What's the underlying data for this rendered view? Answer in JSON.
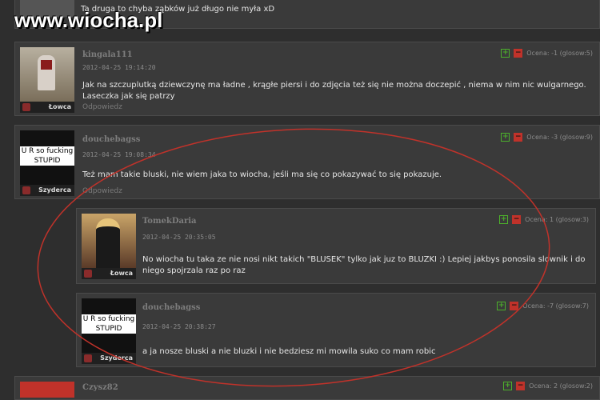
{
  "watermark": "www.wiocha.pl",
  "comments": [
    {
      "text": "Ta druga to chyba ząbków już długo nie myła xD"
    },
    {
      "user": "kingala111",
      "date": "2012-04-25 19:14:20",
      "text": "Jak na szczuplutką dziewczynę ma ładne , krągłe piersi i do zdjęcia też się nie można doczepić , niema w nim nic wulgarnego. Laseczka jak się patrzy",
      "rank": "Łowca",
      "rating": "Ocena: -1 (glosow:5)",
      "reply": "Odpowiedz"
    },
    {
      "user": "douchebagss",
      "date": "2012-04-25 19:08:34",
      "text": "Też mam takie bluski, nie wiem jaka to wiocha, jeśli ma się co pokazywać to się pokazuje.",
      "rank": "Szyderca",
      "rating": "Ocena: -3 (glosow:9)",
      "reply": "Odpowiedz",
      "avatar_text": "U R so fucking STUPID"
    },
    {
      "user": "TomekDaria",
      "date": "2012-04-25 20:35:05",
      "text": "No wiocha tu taka ze nie nosi nikt takich \"BLUSEK\" tylko jak juz to BLUZKI :) Lepiej jakbys ponosila slownik i do niego spojrzala raz po raz",
      "rank": "Łowca",
      "rating": "Ocena: 1 (glosow:3)"
    },
    {
      "user": "douchebagss",
      "date": "2012-04-25 20:38:27",
      "text": "a ja nosze bluski a nie bluzki i nie bedziesz mi mowila suko co mam robic",
      "rank": "Szyderca",
      "rating": "Ocena: -7 (glosow:7)",
      "avatar_text": "U R so fucking STUPID"
    },
    {
      "user": "Czysz82",
      "rating": "Ocena: 2 (glosow:2)"
    }
  ],
  "colors": {
    "upvote": "#4caf2b",
    "downvote": "#c0322a",
    "annotation": "#c0322a"
  }
}
